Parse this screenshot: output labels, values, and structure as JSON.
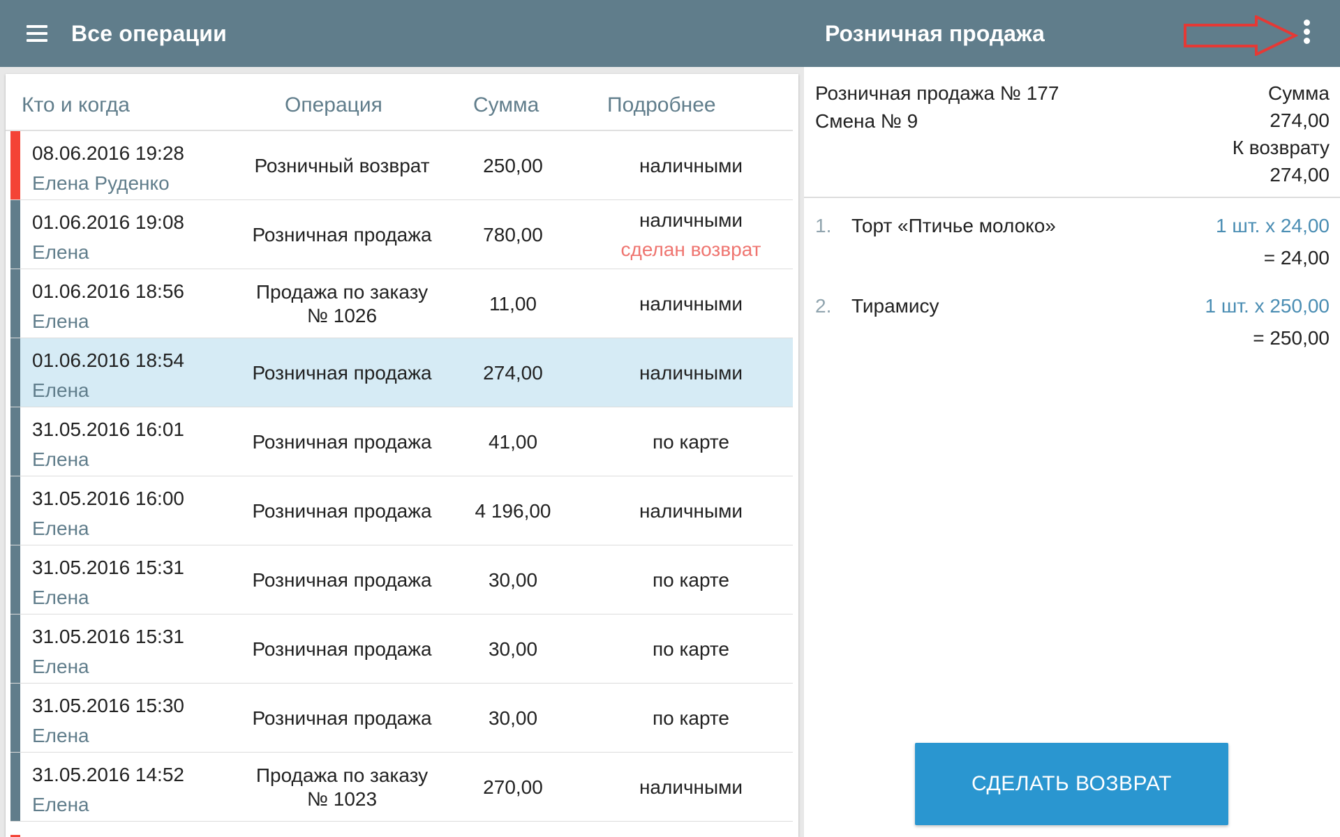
{
  "appbar": {
    "title": "Все операции",
    "detail_title": "Розничная продажа",
    "accent": "#607d8b",
    "icons": [
      "menu-icon",
      "more-vert-icon"
    ]
  },
  "list": {
    "headers": {
      "who": "Кто и когда",
      "operation": "Операция",
      "amount": "Сумма",
      "details": "Подробнее"
    },
    "rows": [
      {
        "date": "08.06.2016 19:28",
        "person": "Елена Руденко",
        "operation": "Розничный возврат",
        "amount": "250,00",
        "details": "наличными",
        "note": "",
        "kind": "refund"
      },
      {
        "date": "01.06.2016 19:08",
        "person": "Елена",
        "operation": "Розничная продажа",
        "amount": "780,00",
        "details": "наличными",
        "note": "сделан возврат",
        "kind": "sale"
      },
      {
        "date": "01.06.2016 18:56",
        "person": "Елена",
        "operation": "Продажа по заказу № 1026",
        "amount": "11,00",
        "details": "наличными",
        "note": "",
        "kind": "sale"
      },
      {
        "date": "01.06.2016 18:54",
        "person": "Елена",
        "operation": "Розничная продажа",
        "amount": "274,00",
        "details": "наличными",
        "note": "",
        "kind": "sale",
        "selected": true
      },
      {
        "date": "31.05.2016 16:01",
        "person": "Елена",
        "operation": "Розничная продажа",
        "amount": "41,00",
        "details": "по карте",
        "note": "",
        "kind": "sale"
      },
      {
        "date": "31.05.2016 16:00",
        "person": "Елена",
        "operation": "Розничная продажа",
        "amount": "4 196,00",
        "details": "наличными",
        "note": "",
        "kind": "sale"
      },
      {
        "date": "31.05.2016 15:31",
        "person": "Елена",
        "operation": "Розничная продажа",
        "amount": "30,00",
        "details": "по карте",
        "note": "",
        "kind": "sale"
      },
      {
        "date": "31.05.2016 15:31",
        "person": "Елена",
        "operation": "Розничная продажа",
        "amount": "30,00",
        "details": "по карте",
        "note": "",
        "kind": "sale"
      },
      {
        "date": "31.05.2016 15:30",
        "person": "Елена",
        "operation": "Розничная продажа",
        "amount": "30,00",
        "details": "по карте",
        "note": "",
        "kind": "sale"
      },
      {
        "date": "31.05.2016 14:52",
        "person": "Елена",
        "operation": "Продажа по заказу № 1023",
        "amount": "270,00",
        "details": "наличными",
        "note": "",
        "kind": "sale"
      }
    ]
  },
  "detail": {
    "sale_number": "Розничная продажа № 177",
    "shift": "Смена № 9",
    "sum_label": "Сумма",
    "sum_value": "274,00",
    "refund_label": "К возврату",
    "refund_value": "274,00",
    "items": [
      {
        "num": "1.",
        "name": "Торт «Птичье молоко»",
        "qty": "1 шт. x 24,00",
        "total": "= 24,00"
      },
      {
        "num": "2.",
        "name": "Тирамису",
        "qty": "1 шт. x 250,00",
        "total": "= 250,00"
      }
    ],
    "return_button": "СДЕЛАТЬ ВОЗВРАТ",
    "button_color": "#2a96d0"
  }
}
